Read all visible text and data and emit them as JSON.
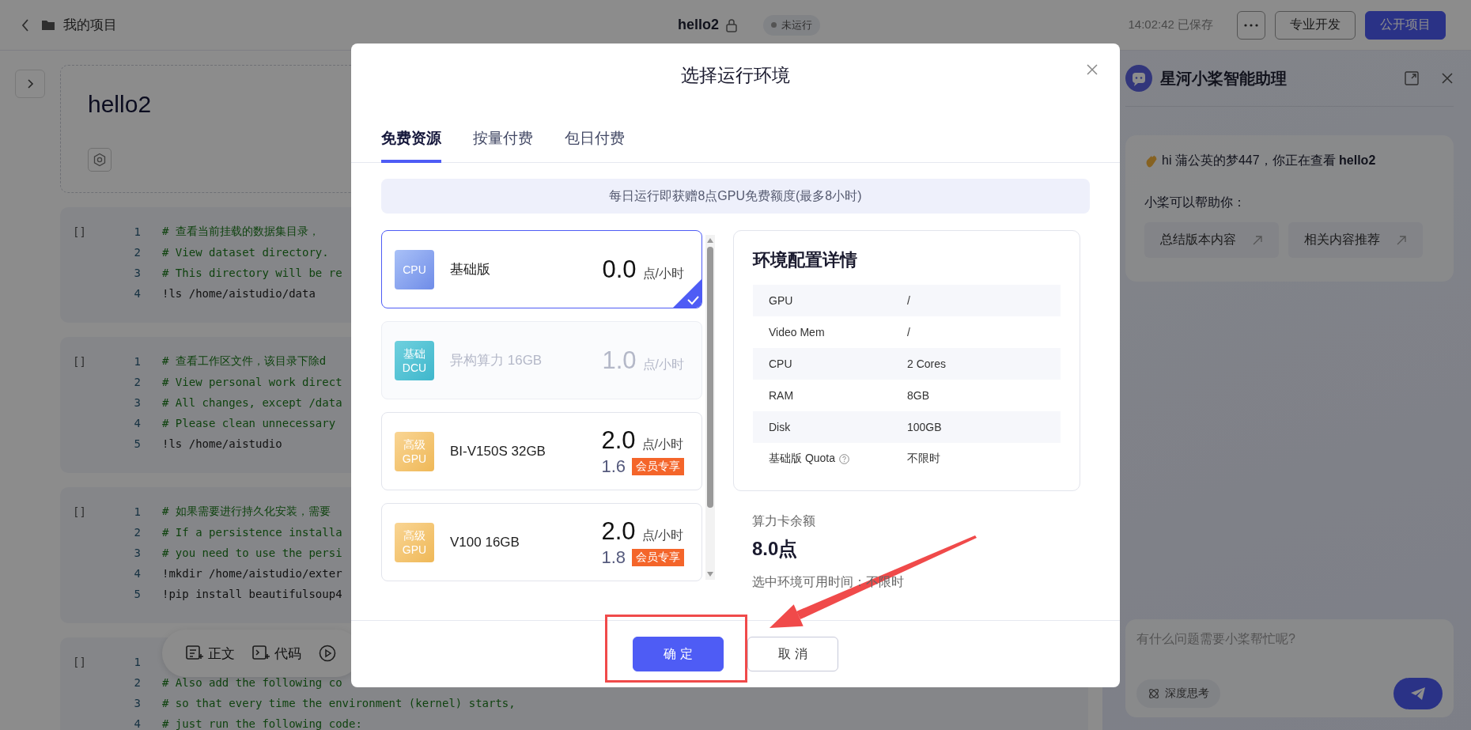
{
  "topbar": {
    "breadcrumb": "我的项目",
    "project_title": "hello2",
    "status": "未运行",
    "saved": "14:02:42 已保存",
    "buttons": [
      {
        "label": "专业开发",
        "kind": "secondary"
      },
      {
        "label": "公开项目",
        "kind": "primary"
      }
    ]
  },
  "notebook": {
    "title": "hello2",
    "cells": [
      {
        "prompt": "[]",
        "lines": [
          {
            "number": "1",
            "kind": "comment",
            "text": "# 查看当前挂载的数据集目录，"
          },
          {
            "number": "2",
            "kind": "comment",
            "text": "# View dataset directory."
          },
          {
            "number": "3",
            "kind": "comment",
            "text": "# This directory will be re"
          },
          {
            "number": "4",
            "kind": "command",
            "text": "!ls /home/aistudio/data"
          }
        ]
      },
      {
        "prompt": "[]",
        "lines": [
          {
            "number": "1",
            "kind": "comment",
            "text": "# 查看工作区文件，该目录下除d"
          },
          {
            "number": "2",
            "kind": "comment",
            "text": "# View personal work direct"
          },
          {
            "number": "3",
            "kind": "comment",
            "text": "# All changes, except /data"
          },
          {
            "number": "4",
            "kind": "comment",
            "text": "# Please clean unnecessary"
          },
          {
            "number": "5",
            "kind": "command",
            "text": "!ls /home/aistudio"
          }
        ]
      },
      {
        "prompt": "[]",
        "lines": [
          {
            "number": "1",
            "kind": "comment",
            "text": "# 如果需要进行持久化安装，需要"
          },
          {
            "number": "2",
            "kind": "comment",
            "text": "# If a persistence installa"
          },
          {
            "number": "3",
            "kind": "comment",
            "text": "# you need to use the persi"
          },
          {
            "number": "4",
            "kind": "command",
            "text": "!mkdir /home/aistudio/exter"
          },
          {
            "number": "5",
            "kind": "command",
            "text": "!pip install beautifulsoup4"
          }
        ]
      },
      {
        "prompt": "[]",
        "lines": [
          {
            "number": "1"
          },
          {
            "number": "2",
            "kind": "comment",
            "text": "# Also add the following co"
          },
          {
            "number": "3",
            "kind": "comment",
            "text": "# so that every time the environment (kernel) starts,"
          },
          {
            "number": "4",
            "kind": "comment",
            "text": "# just run the following code:"
          }
        ]
      }
    ]
  },
  "toolbar": {
    "items": [
      {
        "label": "正文",
        "kind": "text"
      },
      {
        "label": "代码",
        "kind": "code"
      }
    ]
  },
  "modal": {
    "title": "选择运行环境",
    "tabs": [
      {
        "label": "免费资源",
        "selected": true
      },
      {
        "label": "按量付费",
        "selected": false
      },
      {
        "label": "包日付费",
        "selected": false
      }
    ],
    "banner": "每日运行即获赠8点GPU免费额度(最多8小时)",
    "environments": [
      {
        "kind": "cpu",
        "badge": [
          "CPU"
        ],
        "name": "基础版",
        "price": "0.0",
        "unit": "点/小时",
        "selected": true,
        "disabled": false
      },
      {
        "kind": "dcu",
        "badge": [
          "基础",
          "DCU"
        ],
        "name": "异构算力 16GB",
        "price": "1.0",
        "unit": "点/小时",
        "selected": false,
        "disabled": true
      },
      {
        "kind": "gpu",
        "badge": [
          "高级",
          "GPU"
        ],
        "name": "BI-V150S 32GB",
        "price": "2.0",
        "unit": "点/小时",
        "member_price": "1.6",
        "member_badge": "会员专享",
        "selected": false,
        "disabled": false
      },
      {
        "kind": "gpu",
        "badge": [
          "高级",
          "GPU"
        ],
        "name": "V100 16GB",
        "price": "2.0",
        "unit": "点/小时",
        "member_price": "1.8",
        "member_badge": "会员专享",
        "selected": false,
        "disabled": false
      }
    ],
    "details": {
      "title": "环境配置详情",
      "rows": [
        {
          "label": "GPU",
          "value": "/",
          "help": false
        },
        {
          "label": "Video Mem",
          "value": "/",
          "help": false
        },
        {
          "label": "CPU",
          "value": "2 Cores",
          "help": false
        },
        {
          "label": "RAM",
          "value": "8GB",
          "help": false
        },
        {
          "label": "Disk",
          "value": "100GB",
          "help": false
        },
        {
          "label": "基础版 Quota",
          "value": "不限时",
          "help": true
        }
      ]
    },
    "balance": {
      "label": "算力卡余额",
      "value": "8.0点"
    },
    "available": "选中环境可用时间：不限时",
    "buttons": [
      {
        "label": "确 定",
        "kind": "primary"
      },
      {
        "label": "取 消",
        "kind": "secondary"
      }
    ]
  },
  "assistant": {
    "title": "星河小桨智能助理",
    "greeting": "hi 蒲公英的梦447，你正在查看 **hello2**",
    "help_label": "小桨可以帮助你：",
    "suggestions": [
      "总结版本内容",
      "相关内容推荐"
    ],
    "input": {
      "placeholder": "有什么问题需要小桨帮忙呢?"
    },
    "deep_think": "深度思考"
  }
}
